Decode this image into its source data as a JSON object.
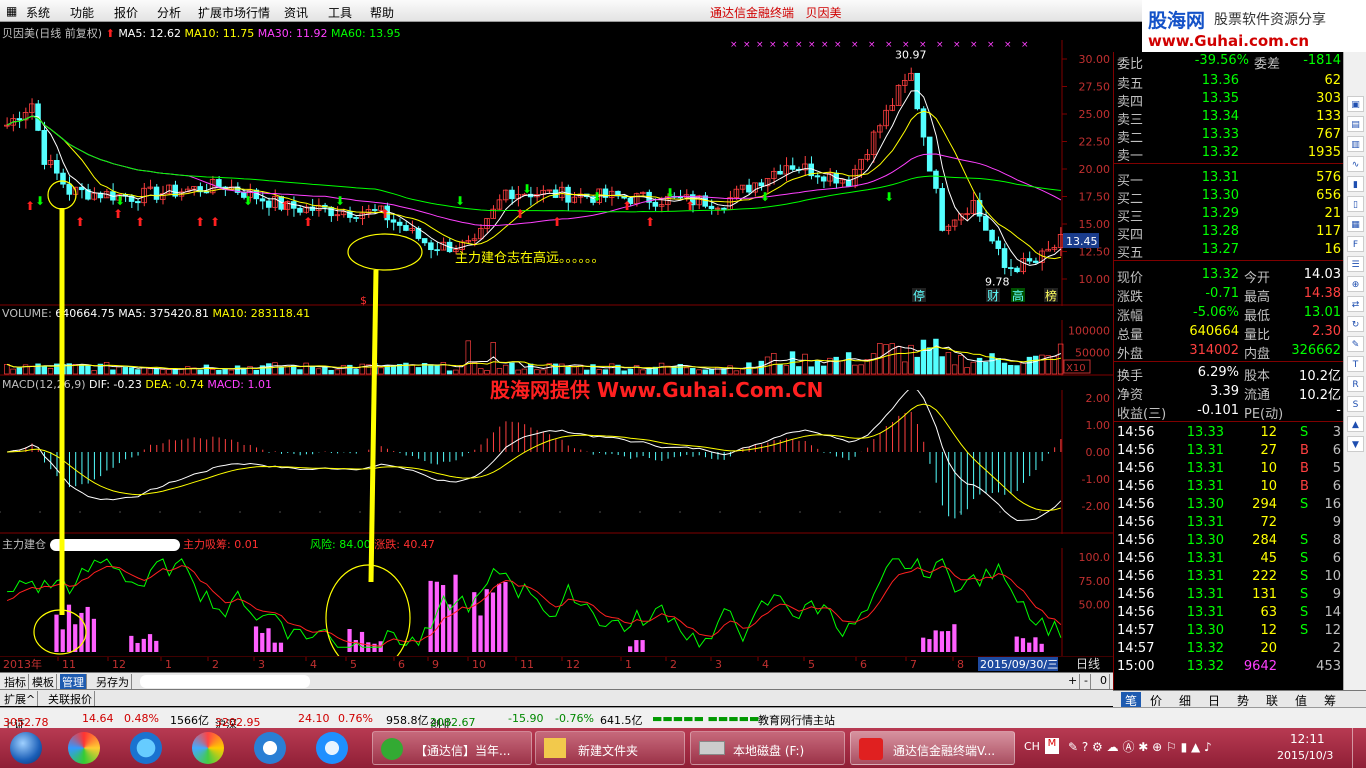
{
  "menu": {
    "items": [
      "系统",
      "功能",
      "报价",
      "分析",
      "扩展市场行情",
      "资讯",
      "工具",
      "帮助"
    ],
    "app_title": "通达信金融终端",
    "stock_name": "贝因美",
    "window_controls": [
      "minimize",
      "restore",
      "close"
    ]
  },
  "logo": {
    "name": "股海网",
    "slogan": "股票软件资源分享",
    "url": "www.Guhai.com.cn"
  },
  "main_chart": {
    "title": "贝因美(日线 前复权)",
    "ma": [
      {
        "label": "MA5: 12.62",
        "color": "#ffffff"
      },
      {
        "label": "MA10: 11.75",
        "color": "#ffff00"
      },
      {
        "label": "MA30: 11.92",
        "color": "#ff40ff"
      },
      {
        "label": "MA60: 13.95",
        "color": "#00ff00"
      }
    ],
    "price_axis": [
      "30.00",
      "27.50",
      "25.00",
      "22.50",
      "20.00",
      "17.50",
      "15.00",
      "12.50",
      "10.00"
    ],
    "current_price_tag": "13.45",
    "high_label": "30.97",
    "low_label": "9.78",
    "annotation": "主力建仓志在高远。。。。。。",
    "event_labels": [
      "停",
      "财",
      "高",
      "榜"
    ],
    "volume_label": "$"
  },
  "volume_panel": {
    "title": "VOLUME:",
    "vol": "640664.75",
    "ma5": "MA5: 375420.81",
    "ma10": "MA10: 283118.41",
    "axis": [
      "100000",
      "50000"
    ],
    "unit": "X10"
  },
  "macd_panel": {
    "title": "MACD(12,26,9)",
    "dif": "DIF: -0.23",
    "dea": "DEA: -0.74",
    "macd": "MACD: 1.01",
    "axis": [
      "2.00",
      "1.00",
      "0.00",
      "-1.00",
      "-2.00"
    ],
    "watermark": "股海网提供 Www.Guhai.Com.CN"
  },
  "zljc_panel": {
    "title": "主力建仓",
    "absorb": "主力吸筹: 0.01",
    "risk": "风险: 84.00",
    "change": "涨跌: 40.47",
    "axis": [
      "100.0",
      "75.00",
      "50.00"
    ]
  },
  "time_axis": {
    "year_label": "2013年",
    "months": [
      "11",
      "12",
      "1",
      "2",
      "3",
      "4",
      "5",
      "6",
      "9",
      "10",
      "11",
      "12",
      "1",
      "2",
      "3",
      "4",
      "5",
      "6",
      "7",
      "8"
    ],
    "date_box": "2015/09/30/三",
    "period": "日线"
  },
  "bottom_tabs": [
    "指标",
    "模板",
    "管理",
    "另存为"
  ],
  "ext_tabs": [
    "扩展^",
    "关联报价"
  ],
  "zoom_controls": [
    "+",
    "-",
    "0"
  ],
  "quote": {
    "weibi": {
      "label": "委比",
      "value": "-39.56%",
      "label2": "委差",
      "value2": "-1814"
    },
    "asks": [
      {
        "label": "卖五",
        "price": "13.36",
        "vol": "62"
      },
      {
        "label": "卖四",
        "price": "13.35",
        "vol": "303"
      },
      {
        "label": "卖三",
        "price": "13.34",
        "vol": "133"
      },
      {
        "label": "卖二",
        "price": "13.33",
        "vol": "767"
      },
      {
        "label": "卖一",
        "price": "13.32",
        "vol": "1935"
      }
    ],
    "bids": [
      {
        "label": "买一",
        "price": "13.31",
        "vol": "576"
      },
      {
        "label": "买二",
        "price": "13.30",
        "vol": "656"
      },
      {
        "label": "买三",
        "price": "13.29",
        "vol": "21"
      },
      {
        "label": "买四",
        "price": "13.28",
        "vol": "117"
      },
      {
        "label": "买五",
        "price": "13.27",
        "vol": "16"
      }
    ],
    "stats": [
      {
        "l1": "现价",
        "v1": "13.32",
        "c1": "#00ff00",
        "l2": "今开",
        "v2": "14.03",
        "c2": "#ffffff"
      },
      {
        "l1": "涨跌",
        "v1": "-0.71",
        "c1": "#00ff00",
        "l2": "最高",
        "v2": "14.38",
        "c2": "#ff4040"
      },
      {
        "l1": "涨幅",
        "v1": "-5.06%",
        "c1": "#00ff00",
        "l2": "最低",
        "v2": "13.01",
        "c2": "#00ff00"
      },
      {
        "l1": "总量",
        "v1": "640664",
        "c1": "#ffff00",
        "l2": "量比",
        "v2": "2.30",
        "c2": "#ff4040"
      },
      {
        "l1": "外盘",
        "v1": "314002",
        "c1": "#ff4040",
        "l2": "内盘",
        "v2": "326662",
        "c2": "#00ff00"
      }
    ],
    "fund": [
      {
        "l1": "换手",
        "v1": "6.29%",
        "l2": "股本",
        "v2": "10.2亿"
      },
      {
        "l1": "净资",
        "v1": "3.39",
        "l2": "流通",
        "v2": "10.2亿"
      },
      {
        "l1": "收益(三)",
        "v1": "-0.101",
        "l2": "PE(动)",
        "v2": "-"
      }
    ],
    "ticks": [
      {
        "t": "14:56",
        "p": "13.33",
        "v": "12",
        "d": "S",
        "n": "3"
      },
      {
        "t": "14:56",
        "p": "13.31",
        "v": "27",
        "d": "B",
        "n": "6"
      },
      {
        "t": "14:56",
        "p": "13.31",
        "v": "10",
        "d": "B",
        "n": "5"
      },
      {
        "t": "14:56",
        "p": "13.31",
        "v": "10",
        "d": "B",
        "n": "6"
      },
      {
        "t": "14:56",
        "p": "13.30",
        "v": "294",
        "d": "S",
        "n": "16"
      },
      {
        "t": "14:56",
        "p": "13.31",
        "v": "72",
        "d": "",
        "n": "9"
      },
      {
        "t": "14:56",
        "p": "13.30",
        "v": "284",
        "d": "S",
        "n": "8"
      },
      {
        "t": "14:56",
        "p": "13.31",
        "v": "45",
        "d": "S",
        "n": "6"
      },
      {
        "t": "14:56",
        "p": "13.31",
        "v": "222",
        "d": "S",
        "n": "10"
      },
      {
        "t": "14:56",
        "p": "13.31",
        "v": "131",
        "d": "S",
        "n": "9"
      },
      {
        "t": "14:56",
        "p": "13.31",
        "v": "63",
        "d": "S",
        "n": "14"
      },
      {
        "t": "14:57",
        "p": "13.30",
        "v": "12",
        "d": "S",
        "n": "12"
      },
      {
        "t": "14:57",
        "p": "13.32",
        "v": "20",
        "d": "",
        "n": "2"
      },
      {
        "t": "15:00",
        "p": "13.32",
        "v": "9642",
        "d": "",
        "n": "453"
      }
    ],
    "side_tabs": [
      "笔",
      "价",
      "细",
      "日",
      "势",
      "联",
      "值",
      "筹"
    ]
  },
  "status": {
    "sh_label": "上证",
    "sh_value": "3052.78",
    "sh_chg": "14.64",
    "sh_pct": "0.48%",
    "sh_amt": "1566亿",
    "sz_label": "沪深",
    "sz_value": "3202.95",
    "sz_chg": "24.10",
    "sz_pct": "0.76%",
    "sz_amt": "958.8亿",
    "cy_label": "创业",
    "cy_value": "2082.67",
    "cy_chg": "-15.90",
    "cy_pct": "-0.76%",
    "cy_amt": "641.5亿",
    "msg": "教育网行情主站"
  },
  "taskbar": {
    "buttons": [
      "【通达信】当年...",
      "新建文件夹",
      "本地磁盘 (F:)",
      "通达信金融终端V..."
    ],
    "lang": "CH",
    "time": "12:11",
    "date": "2015/10/3"
  },
  "colors": {
    "up": "#ff4040",
    "down": "#00ff00",
    "axis": "#800000",
    "yellow": "#ffff00"
  }
}
